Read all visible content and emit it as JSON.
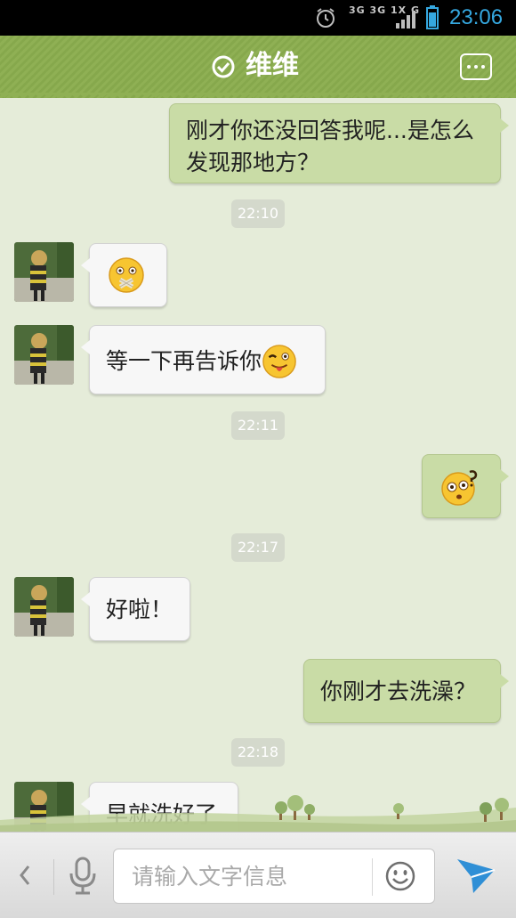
{
  "status_bar": {
    "network": "3G 3G 1X G",
    "time": "23:06",
    "accent_color": "#35a8e0"
  },
  "header": {
    "title": "维维",
    "verified_icon": "check-circle-icon",
    "more_icon": "more-dots-icon",
    "color": "#8fb054"
  },
  "messages": [
    {
      "type": "out",
      "text": "刚才你还没回答我呢...是怎么发现那地方？"
    },
    {
      "type": "time",
      "text": "22:10"
    },
    {
      "type": "in",
      "text": "",
      "emoji": "sealed-mouth-emoji-icon"
    },
    {
      "type": "in",
      "text": "等一下再告诉你",
      "emoji": "wink-tongue-emoji-icon"
    },
    {
      "type": "time",
      "text": "22:11"
    },
    {
      "type": "out",
      "text": "",
      "emoji": "confused-question-emoji-icon"
    },
    {
      "type": "time",
      "text": "22:17"
    },
    {
      "type": "in",
      "text": "好啦！"
    },
    {
      "type": "out",
      "text": "你刚才去洗澡？"
    },
    {
      "type": "time",
      "text": "22:18"
    },
    {
      "type": "in",
      "text": "早就洗好了"
    }
  ],
  "input_bar": {
    "placeholder": "请输入文字信息",
    "back_icon": "chevron-left-icon",
    "voice_icon": "microphone-icon",
    "emoji_icon": "smiley-icon",
    "send_icon": "send-arrow-icon",
    "send_color": "#2f8fd6"
  }
}
